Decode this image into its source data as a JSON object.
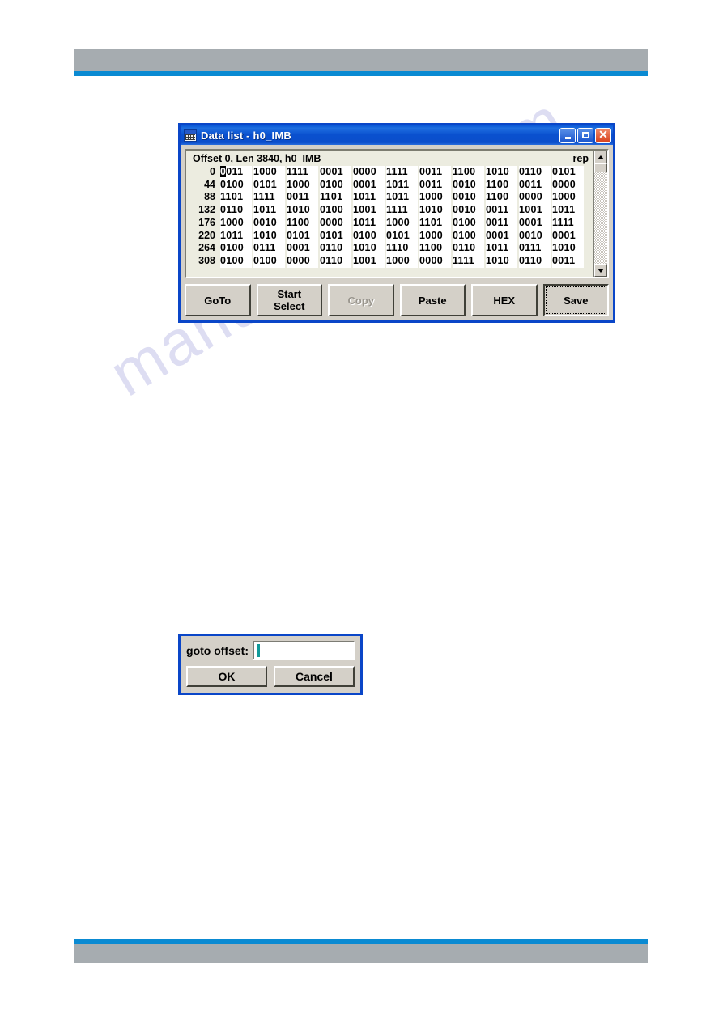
{
  "watermark": {
    "text": "manualshive.com"
  },
  "dialog": {
    "title": "Data list - h0_IMB",
    "icon": "data-list-icon",
    "title_buttons": {
      "minimize": "_",
      "maximize": "□",
      "close": "✕"
    },
    "header": {
      "left": "Offset 0, Len 3840,  h0_IMB",
      "right": "rep"
    },
    "rows": [
      {
        "offset": "0",
        "groups": [
          "0011",
          "1000",
          "1111",
          "0001",
          "0000",
          "1111",
          "0011",
          "1100",
          "1010",
          "0110",
          "0101"
        ],
        "cursor": true
      },
      {
        "offset": "44",
        "groups": [
          "0100",
          "0101",
          "1000",
          "0100",
          "0001",
          "1011",
          "0011",
          "0010",
          "1100",
          "0011",
          "0000"
        ],
        "cursor": false
      },
      {
        "offset": "88",
        "groups": [
          "1101",
          "1111",
          "0011",
          "1101",
          "1011",
          "1011",
          "1000",
          "0010",
          "1100",
          "0000",
          "1000"
        ],
        "cursor": false
      },
      {
        "offset": "132",
        "groups": [
          "0110",
          "1011",
          "1010",
          "0100",
          "1001",
          "1111",
          "1010",
          "0010",
          "0011",
          "1001",
          "1011"
        ],
        "cursor": false
      },
      {
        "offset": "176",
        "groups": [
          "1000",
          "0010",
          "1100",
          "0000",
          "1011",
          "1000",
          "1101",
          "0100",
          "0011",
          "0001",
          "1111"
        ],
        "cursor": false
      },
      {
        "offset": "220",
        "groups": [
          "1011",
          "1010",
          "0101",
          "0101",
          "0100",
          "0101",
          "1000",
          "0100",
          "0001",
          "0010",
          "0001"
        ],
        "cursor": false
      },
      {
        "offset": "264",
        "groups": [
          "0100",
          "0111",
          "0001",
          "0110",
          "1010",
          "1110",
          "1100",
          "0110",
          "1011",
          "0111",
          "1010"
        ],
        "cursor": false
      },
      {
        "offset": "308",
        "groups": [
          "0100",
          "0100",
          "0000",
          "0110",
          "1001",
          "1000",
          "0000",
          "1111",
          "1010",
          "0110",
          "0011"
        ],
        "cursor": false
      }
    ],
    "scrollbar": {
      "up_icon": "scroll-up-arrow-icon",
      "down_icon": "scroll-down-arrow-icon"
    },
    "buttons": [
      {
        "label": "GoTo",
        "line1": "GoTo",
        "line2": "",
        "state": "normal"
      },
      {
        "label": "Start Select",
        "line1": "Start",
        "line2": "Select",
        "state": "normal"
      },
      {
        "label": "Copy",
        "line1": "Copy",
        "line2": "",
        "state": "disabled"
      },
      {
        "label": "Paste",
        "line1": "Paste",
        "line2": "",
        "state": "normal"
      },
      {
        "label": "HEX",
        "line1": "HEX",
        "line2": "",
        "state": "normal"
      },
      {
        "label": "Save",
        "line1": "Save",
        "line2": "",
        "state": "focused"
      }
    ]
  },
  "goto_dialog": {
    "label": "goto offset:",
    "label_accel": "g",
    "label_rest": "oto offset:",
    "input_value": "",
    "input_placeholder": "",
    "ok_label": "OK",
    "cancel_label": "Cancel"
  },
  "colors": {
    "title_blue": "#0a50cf",
    "dialog_border": "#0a46c8",
    "face": "#d4d0c8",
    "data_bg": "#ecece0",
    "accent_rule": "#0a8ad2",
    "header_bar": "#a6acb0",
    "caret": "#119a9a"
  }
}
